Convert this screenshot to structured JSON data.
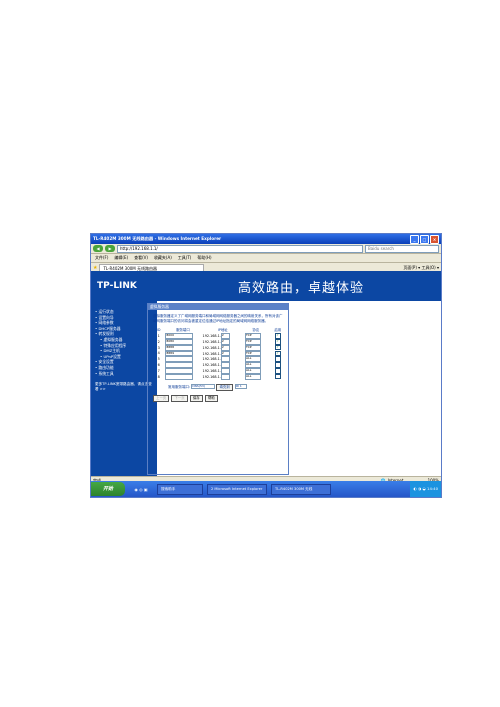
{
  "window": {
    "title": "TL-R402M 300M 无线路由器 - Windows Internet Explorer",
    "address": "http://192.168.1.1/",
    "search_placeholder": "Baidu search",
    "tab": "TL-R402M 300M 无线路由器",
    "tab_tools": "页面(P) ▾ 工具(O) ▾",
    "back": "◀",
    "forward": "▶"
  },
  "menu": [
    "文件(F)",
    "编辑(E)",
    "查看(V)",
    "收藏夹(A)",
    "工具(T)",
    "帮助(H)"
  ],
  "banner": {
    "logo": "TP-LINK",
    "slogan": "高效路由，卓越体验"
  },
  "sidebar": {
    "items": [
      {
        "label": "• 运行状态",
        "sub": false
      },
      {
        "label": "• 设置向导",
        "sub": false
      },
      {
        "label": "• 网络参数",
        "sub": false
      },
      {
        "label": "• DHCP服务器",
        "sub": false
      },
      {
        "label": "• 转发规则",
        "sub": false
      },
      {
        "label": "• 虚拟服务器",
        "sub": true
      },
      {
        "label": "• 特殊应用程序",
        "sub": true
      },
      {
        "label": "• DMZ主机",
        "sub": true
      },
      {
        "label": "• UPnP设置",
        "sub": true
      },
      {
        "label": "• 安全设置",
        "sub": false
      },
      {
        "label": "• 路由功能",
        "sub": false
      },
      {
        "label": "• 系统工具",
        "sub": false
      }
    ],
    "hint": "更多TP-LINK宽带路由器，请点击查看 >>"
  },
  "panel": {
    "heading": "虚拟服务器",
    "description": "虚拟服务器定义了广域网服务端口和局域网网络服务器之间的映射关系，所有对该广域网服务端口的访问将会被重定位给通过IP地址指定的局域网网络服务器。",
    "columns": [
      "ID",
      "服务端口",
      "IP地址",
      "协议",
      "启用"
    ],
    "rows": [
      {
        "id": "1",
        "port": "8000",
        "ip": "192.168.1.",
        "last": "2",
        "proto": "TCP",
        "enabled": "✓"
      },
      {
        "id": "2",
        "port": "8080",
        "ip": "192.168.1.",
        "last": "2",
        "proto": "TCP",
        "enabled": "✓"
      },
      {
        "id": "3",
        "port": "8888",
        "ip": "192.168.1.",
        "last": "2",
        "proto": "TCP",
        "enabled": "✓"
      },
      {
        "id": "4",
        "port": "8889",
        "ip": "192.168.1.",
        "last": "2",
        "proto": "TCP",
        "enabled": "✓"
      },
      {
        "id": "5",
        "port": "",
        "ip": "192.168.1.",
        "last": "",
        "proto": "ALL",
        "enabled": ""
      },
      {
        "id": "6",
        "port": "",
        "ip": "192.168.1.",
        "last": "",
        "proto": "ALL",
        "enabled": ""
      },
      {
        "id": "7",
        "port": "",
        "ip": "192.168.1.",
        "last": "",
        "proto": "ALL",
        "enabled": ""
      },
      {
        "id": "8",
        "port": "",
        "ip": "192.168.1.",
        "last": "",
        "proto": "ALL",
        "enabled": ""
      }
    ],
    "common_label": "常用服务端口:",
    "common_value": "DNS(53)",
    "copy_button": "填充到",
    "copy_target": "ID 1",
    "buttons": [
      "上一页",
      "下一页",
      "保存",
      "帮助"
    ]
  },
  "status": {
    "left": "完成",
    "zone": "Internet",
    "zoom": "100%"
  },
  "taskbar": {
    "start": "开始",
    "items": [
      "搜索助手",
      "2 Microsoft Internet Explorer",
      "TL-R402M 300M 无线"
    ],
    "clock": "14:40"
  }
}
